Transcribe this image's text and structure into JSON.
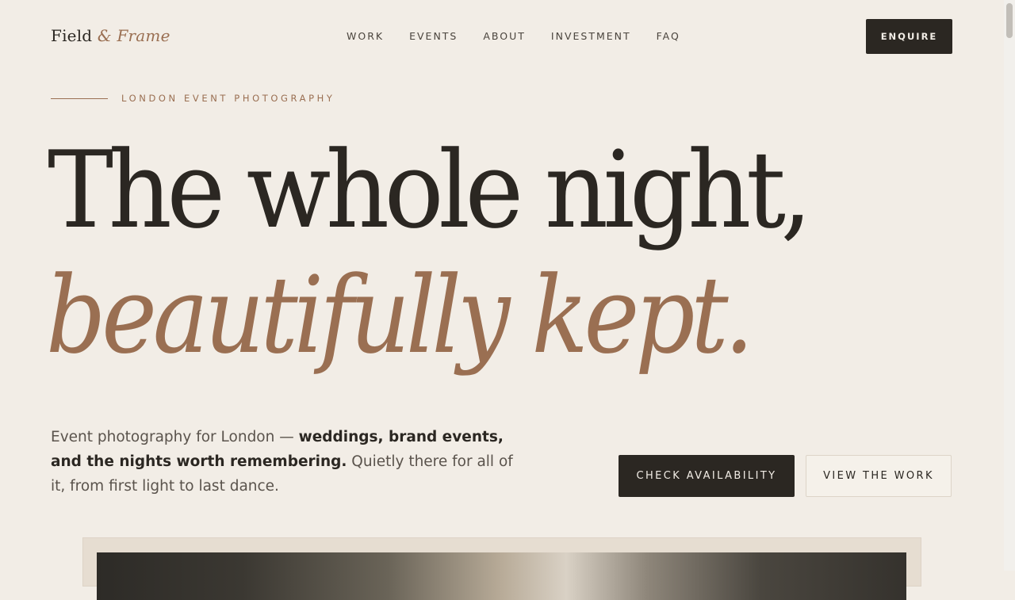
{
  "brand": {
    "part1": "Field",
    "amp": "&",
    "part2": "Frame"
  },
  "nav": {
    "items": [
      "WORK",
      "EVENTS",
      "ABOUT",
      "INVESTMENT",
      "FAQ"
    ],
    "cta": "ENQUIRE"
  },
  "hero": {
    "eyebrow": "LONDON EVENT PHOTOGRAPHY",
    "headline_line1": "The whole night,",
    "headline_line2": "beautifully kept.",
    "intro_lead": "Event photography for London — ",
    "intro_strong": "weddings, brand events, and the nights worth remembering.",
    "intro_tail": " Quietly there for all of it, from first light to last dance.",
    "primary_cta": "CHECK AVAILABILITY",
    "secondary_cta": "VIEW THE WORK"
  },
  "colors": {
    "background": "#f2ede6",
    "ink": "#2b2722",
    "accent": "#9a6f52"
  }
}
